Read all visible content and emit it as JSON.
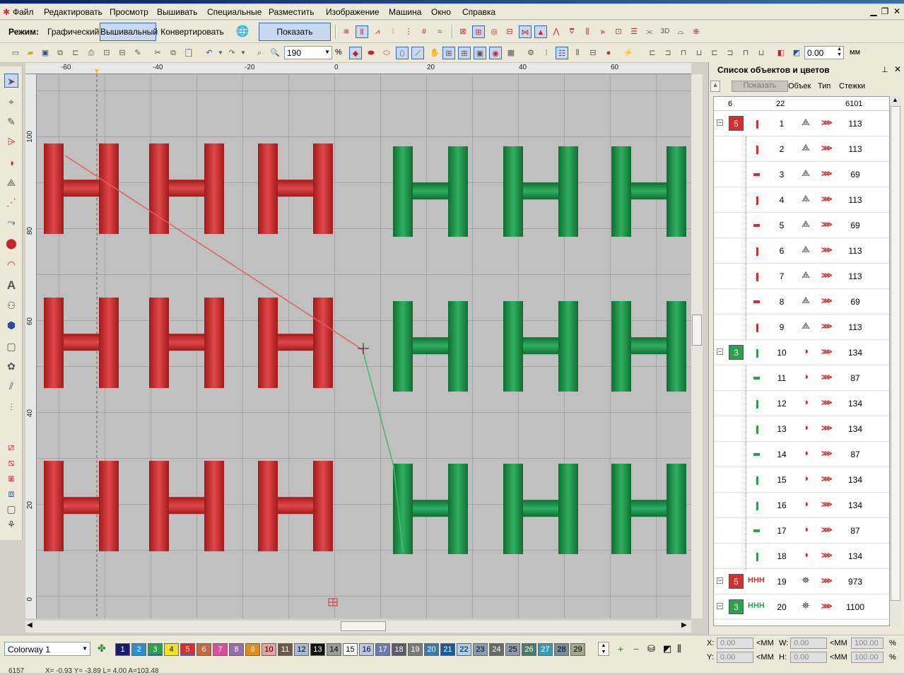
{
  "menu": {
    "items": [
      "Файл",
      "Редактировать",
      "Просмотр",
      "Вышивать",
      "Специальные",
      "Разместить",
      "Изображение",
      "Машина",
      "Окно",
      "Справка"
    ]
  },
  "modebar": {
    "label": "Режим:",
    "graphic": "Графический",
    "embroidery": "Вышивальный",
    "convert": "Конвертировать",
    "show_graphics": "Показать графику"
  },
  "toolbar": {
    "zoom_value": "190",
    "zoom_unit": "%",
    "offset_value": "0.00",
    "offset_unit": "мм"
  },
  "ruler": {
    "top_ticks": [
      "-60",
      "-40",
      "-20",
      "0",
      "20",
      "40",
      "60"
    ],
    "left_ticks": [
      "100",
      "80",
      "60",
      "40",
      "20",
      "0"
    ]
  },
  "panel": {
    "title": "Список объектов и цветов",
    "show_btn": "Показать",
    "col_obj": "Объек",
    "col_type": "Тип",
    "col_stitches": "Стежки",
    "summary": {
      "colors": "6",
      "objects": "22",
      "stitches": "6101"
    },
    "rows": [
      {
        "color_no": "5",
        "color": "#d32f2f",
        "num": "1",
        "stitches": "113",
        "mark": "v",
        "group": true
      },
      {
        "color_no": "",
        "color": "#d32f2f",
        "num": "2",
        "stitches": "113",
        "mark": "v"
      },
      {
        "color_no": "",
        "color": "#d32f2f",
        "num": "3",
        "stitches": "69",
        "mark": "h"
      },
      {
        "color_no": "",
        "color": "#d32f2f",
        "num": "4",
        "stitches": "113",
        "mark": "v"
      },
      {
        "color_no": "",
        "color": "#d32f2f",
        "num": "5",
        "stitches": "69",
        "mark": "h"
      },
      {
        "color_no": "",
        "color": "#d32f2f",
        "num": "6",
        "stitches": "113",
        "mark": "v"
      },
      {
        "color_no": "",
        "color": "#d32f2f",
        "num": "7",
        "stitches": "113",
        "mark": "v"
      },
      {
        "color_no": "",
        "color": "#d32f2f",
        "num": "8",
        "stitches": "69",
        "mark": "h"
      },
      {
        "color_no": "",
        "color": "#d32f2f",
        "num": "9",
        "stitches": "113",
        "mark": "v"
      },
      {
        "color_no": "3",
        "color": "#2e9e4f",
        "num": "10",
        "stitches": "134",
        "mark": "v",
        "group": true
      },
      {
        "color_no": "",
        "color": "#2e9e4f",
        "num": "11",
        "stitches": "87",
        "mark": "h"
      },
      {
        "color_no": "",
        "color": "#2e9e4f",
        "num": "12",
        "stitches": "134",
        "mark": "v"
      },
      {
        "color_no": "",
        "color": "#2e9e4f",
        "num": "13",
        "stitches": "134",
        "mark": "v"
      },
      {
        "color_no": "",
        "color": "#2e9e4f",
        "num": "14",
        "stitches": "87",
        "mark": "h"
      },
      {
        "color_no": "",
        "color": "#2e9e4f",
        "num": "15",
        "stitches": "134",
        "mark": "v"
      },
      {
        "color_no": "",
        "color": "#2e9e4f",
        "num": "16",
        "stitches": "134",
        "mark": "v"
      },
      {
        "color_no": "",
        "color": "#2e9e4f",
        "num": "17",
        "stitches": "87",
        "mark": "h"
      },
      {
        "color_no": "",
        "color": "#2e9e4f",
        "num": "18",
        "stitches": "134",
        "mark": "v"
      },
      {
        "color_no": "5",
        "color": "#d32f2f",
        "num": "19",
        "stitches": "973",
        "mark": "HHH",
        "group": true
      },
      {
        "color_no": "3",
        "color": "#2e9e4f",
        "num": "20",
        "stitches": "1100",
        "mark": "HHH",
        "group": true
      }
    ]
  },
  "colorway": {
    "name": "Colorway 1",
    "swatches": [
      {
        "n": "1",
        "c": "#1a1a6e",
        "fg": "#fff"
      },
      {
        "n": "2",
        "c": "#2a8fd0",
        "fg": "#fff"
      },
      {
        "n": "3",
        "c": "#2e9e4f",
        "fg": "#fff"
      },
      {
        "n": "4",
        "c": "#f2e51c",
        "fg": "#000"
      },
      {
        "n": "5",
        "c": "#d32f2f",
        "fg": "#fff"
      },
      {
        "n": "6",
        "c": "#c46a3a",
        "fg": "#fff"
      },
      {
        "n": "7",
        "c": "#d94fa0",
        "fg": "#fff"
      },
      {
        "n": "8",
        "c": "#9a6ab0",
        "fg": "#fff"
      },
      {
        "n": "9",
        "c": "#e08a20",
        "fg": "#fff"
      },
      {
        "n": "10",
        "c": "#e8a0a0",
        "fg": "#000"
      },
      {
        "n": "11",
        "c": "#6a5a4a",
        "fg": "#fff"
      },
      {
        "n": "12",
        "c": "#a8b8d8",
        "fg": "#000"
      },
      {
        "n": "13",
        "c": "#111111",
        "fg": "#fff"
      },
      {
        "n": "14",
        "c": "#9a9a9a",
        "fg": "#000"
      },
      {
        "n": "15",
        "c": "#ffffff",
        "fg": "#000"
      },
      {
        "n": "16",
        "c": "#b8c8e8",
        "fg": "#000"
      },
      {
        "n": "17",
        "c": "#6a7ab0",
        "fg": "#fff"
      },
      {
        "n": "18",
        "c": "#5a5a6a",
        "fg": "#fff"
      },
      {
        "n": "19",
        "c": "#7a7a7a",
        "fg": "#fff"
      },
      {
        "n": "20",
        "c": "#3a7ab0",
        "fg": "#fff"
      },
      {
        "n": "21",
        "c": "#1a5aa0",
        "fg": "#fff"
      },
      {
        "n": "22",
        "c": "#a8d0f0",
        "fg": "#000"
      },
      {
        "n": "23",
        "c": "#8a9ab0",
        "fg": "#000"
      },
      {
        "n": "24",
        "c": "#6a6a6a",
        "fg": "#fff"
      },
      {
        "n": "25",
        "c": "#8a9aaa",
        "fg": "#000"
      },
      {
        "n": "26",
        "c": "#4a7a6a",
        "fg": "#fff"
      },
      {
        "n": "27",
        "c": "#3a9ab0",
        "fg": "#fff"
      },
      {
        "n": "28",
        "c": "#7a8a9a",
        "fg": "#000"
      },
      {
        "n": "29",
        "c": "#a0a890",
        "fg": "#000"
      }
    ]
  },
  "coords": {
    "x_label": "X:",
    "y_label": "Y:",
    "w_label": "W:",
    "h_label": "H:",
    "x": "0.00",
    "y": "0.00",
    "w": "0.00",
    "h": "0.00",
    "unit": "<MM",
    "pw": "100.00",
    "ph": "100.00",
    "pct": "%"
  },
  "status": {
    "left": "6157",
    "coords": "X= -0.93 Y= -3.89 L= 4.00 A=103.48"
  }
}
